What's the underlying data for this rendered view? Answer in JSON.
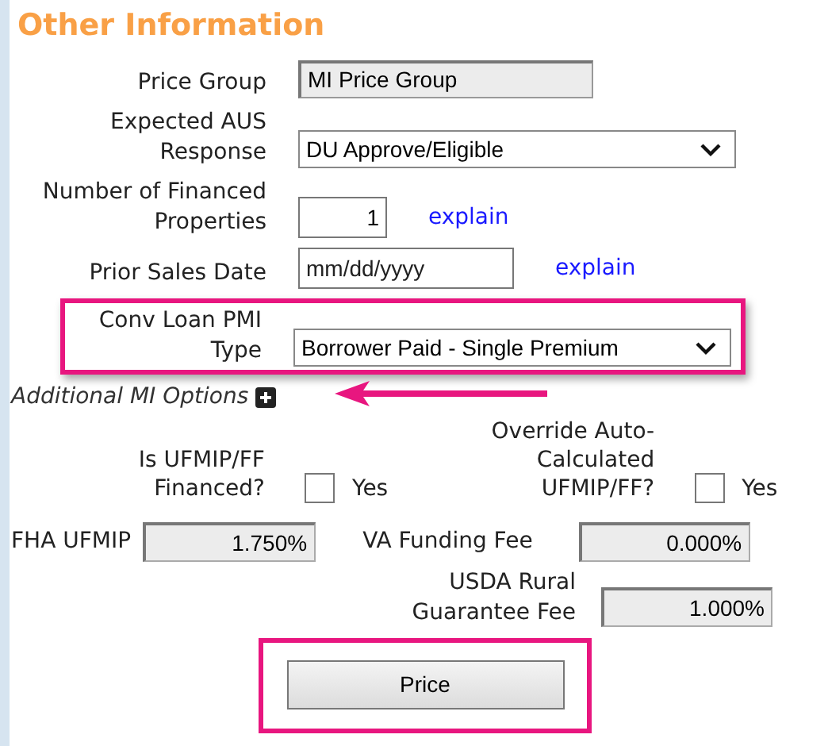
{
  "section": {
    "title": "Other Information"
  },
  "fields": [
    {
      "label": "Price Group",
      "kind": "readonly",
      "value": "MI Price Group",
      "highlighted": false
    },
    {
      "label": "Expected AUS Response",
      "kind": "select",
      "value": "DU Approve/Eligible",
      "highlighted": false
    },
    {
      "label": "Number of Financed Properties",
      "kind": "number",
      "value": "1",
      "link": "explain",
      "highlighted": false
    },
    {
      "label": "Prior Sales Date",
      "kind": "date",
      "placeholder": "mm/dd/yyyy",
      "link": "explain",
      "highlighted": false
    },
    {
      "label": "Conv Loan PMI Type",
      "kind": "select",
      "value": "Borrower Paid - Single Premium",
      "highlighted": true
    }
  ],
  "additional_options": {
    "label": "Additional MI Options",
    "expanded": false,
    "arrow": true
  },
  "checkboxes": [
    {
      "label": "Is UFMIP/FF Financed?",
      "option": "Yes",
      "checked": false
    },
    {
      "label": "Override Auto-Calculated UFMIP/FF?",
      "option": "Yes",
      "checked": false
    }
  ],
  "fees": [
    {
      "label": "FHA UFMIP",
      "value": "1.750%"
    },
    {
      "label": "VA Funding Fee",
      "value": "0.000%"
    },
    {
      "label": "USDA Rural Guarantee Fee",
      "value": "1.000%"
    }
  ],
  "price_button": {
    "label": "Price",
    "highlighted": true
  }
}
